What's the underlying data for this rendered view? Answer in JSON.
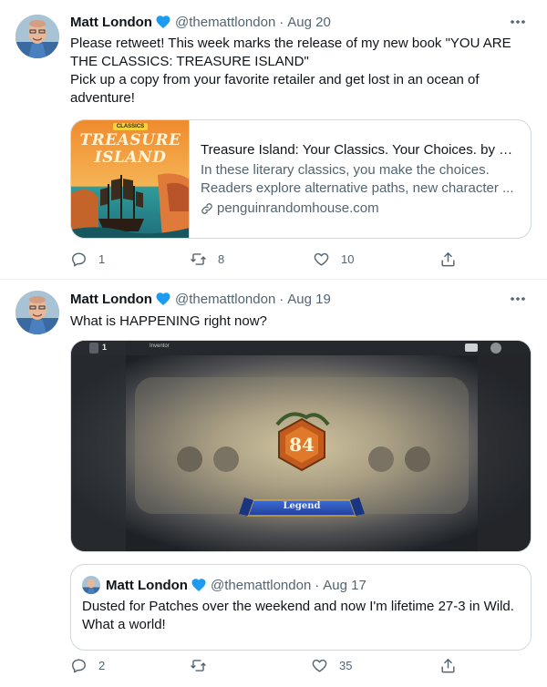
{
  "tweets": [
    {
      "author_name": "Matt London",
      "handle": "@themattlondon",
      "separator": "·",
      "date": "Aug 20",
      "text_lines": [
        "Please retweet! This week marks the release of my new book \"YOU ARE",
        "THE CLASSICS: TREASURE ISLAND\"",
        "Pick up a copy from your favorite retailer and get lost in an ocean of",
        "adventure!"
      ],
      "card": {
        "image_badge": "CLASSICS",
        "image_title_1": "TREASURE",
        "image_title_2": "ISLAND",
        "title": "Treasure Island: Your Classics. Your Choices. by R...",
        "description_lines": [
          "In these literary classics, you make the choices.",
          "Readers explore alternative paths, new character ..."
        ],
        "domain": "penguinrandomhouse.com"
      },
      "replies": "1",
      "retweets": "8",
      "likes": "10"
    },
    {
      "author_name": "Matt London",
      "handle": "@themattlondon",
      "separator": "·",
      "date": "Aug 19",
      "text_lines": [
        "What is HAPPENING right now?"
      ],
      "media": {
        "rank_number": "84",
        "banner_text": "Legend",
        "top_left_count": "1",
        "top_label": "Inventor"
      },
      "quote": {
        "author_name": "Matt London",
        "handle": "@themattlondon",
        "separator": "·",
        "date": "Aug 17",
        "text_lines": [
          "Dusted for Patches over the weekend and now I'm lifetime 27-3 in Wild.",
          "What a world!"
        ]
      },
      "replies": "2",
      "retweets": "",
      "likes": "35"
    }
  ],
  "icons": {
    "verified": "verified-badge-icon",
    "more": "more-options-icon",
    "reply": "reply-icon",
    "retweet": "retweet-icon",
    "like": "like-icon",
    "share": "share-icon",
    "link": "link-icon"
  },
  "colors": {
    "verified_blue": "#1d9bf0",
    "secondary_text": "#536471",
    "primary_text": "#0f1419",
    "border": "#cfd9de"
  }
}
